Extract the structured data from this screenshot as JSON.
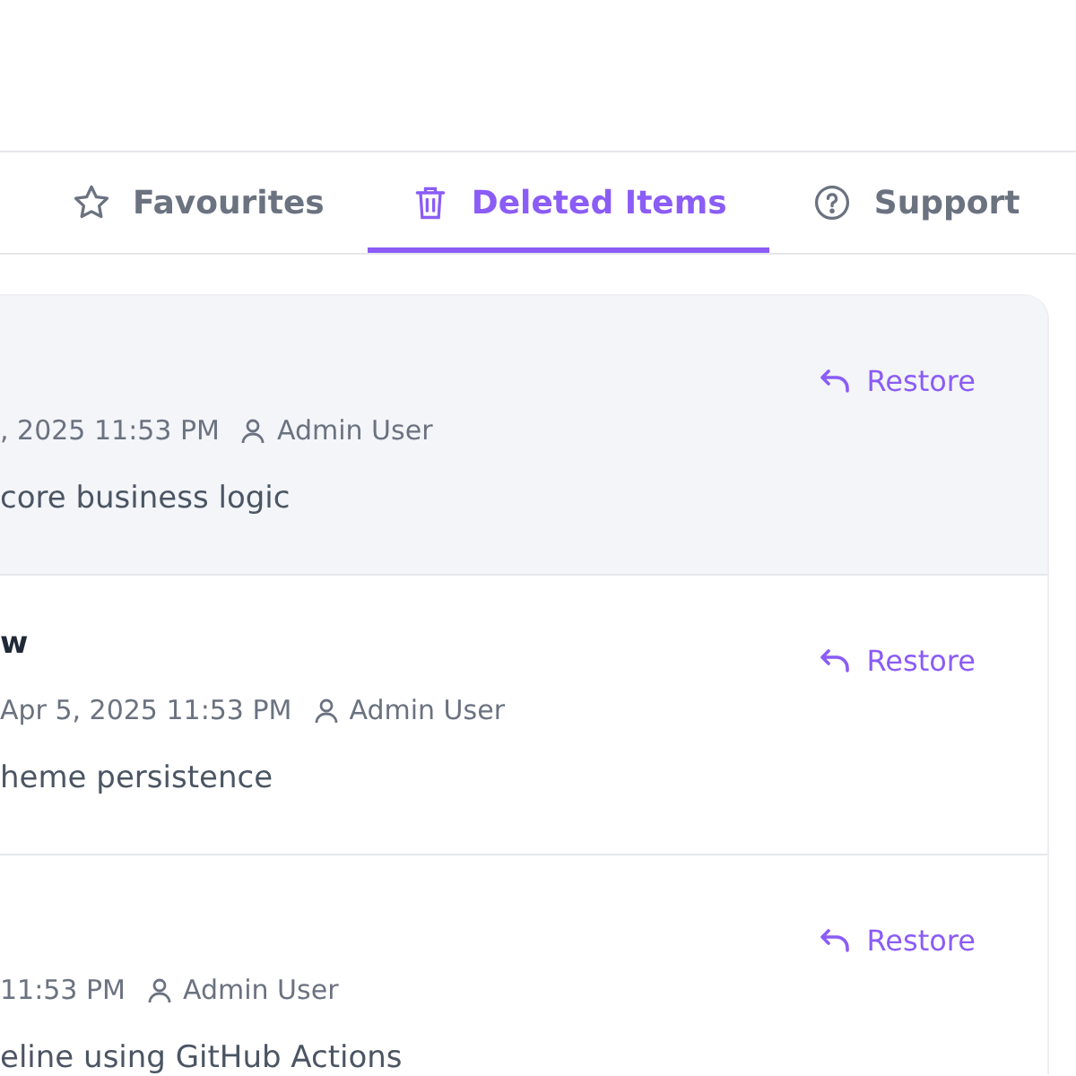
{
  "tabs": [
    {
      "label": "Favourites",
      "kind": "star",
      "selected": false
    },
    {
      "label": "Deleted Items",
      "kind": "trash",
      "selected": true
    },
    {
      "label": "Support",
      "kind": "help",
      "selected": false
    }
  ],
  "items": [
    {
      "deleted_at": ", 2025 11:53 PM",
      "user": "Admin User",
      "description": "core business logic",
      "highlighted": true,
      "action": "Restore"
    },
    {
      "title": "w",
      "deleted_at": "Apr 5, 2025 11:53 PM",
      "user": "Admin User",
      "description": "heme persistence",
      "highlighted": false,
      "action": "Restore"
    },
    {
      "deleted_at": "11:53 PM",
      "user": "Admin User",
      "description": "eline using GitHub Actions",
      "highlighted": false,
      "action": "Restore"
    }
  ]
}
